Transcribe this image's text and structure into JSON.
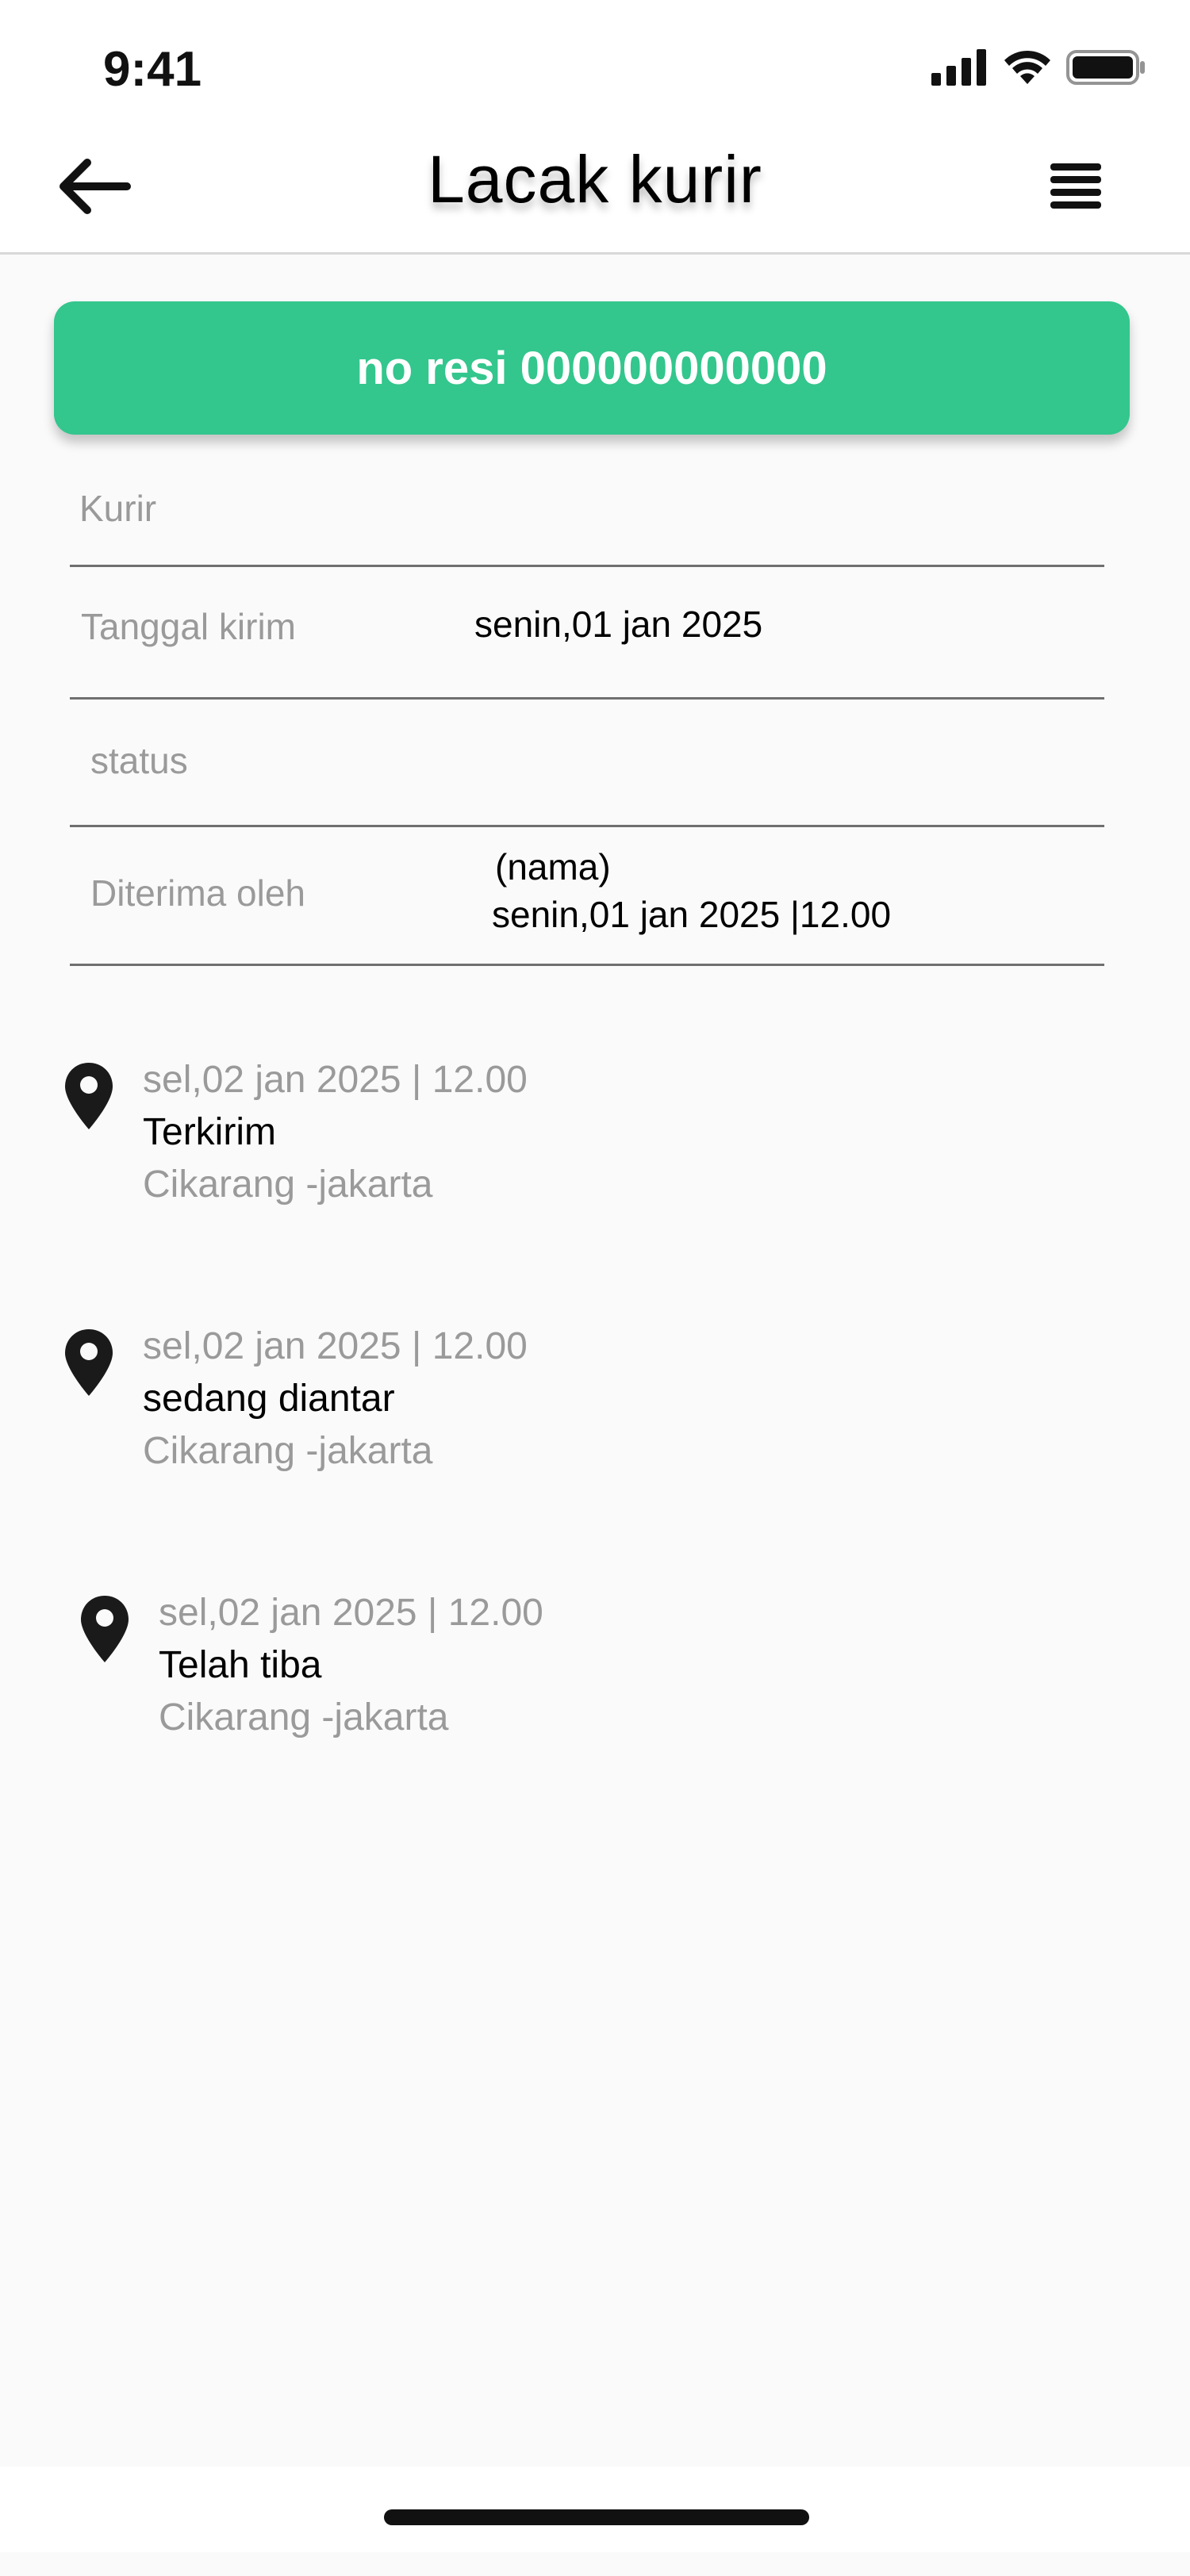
{
  "status_bar": {
    "time": "9:41"
  },
  "header": {
    "title": "Lacak  kurir"
  },
  "resi": {
    "label": "no resi 000000000000"
  },
  "info": {
    "kurir_label": "Kurir",
    "tanggal_label": "Tanggal kirim",
    "tanggal_value": "senin,01 jan 2025",
    "status_label": "status",
    "diterima_label": "Diterima oleh",
    "diterima_name": "(nama)",
    "diterima_datetime": "senin,01 jan 2025 |12.00"
  },
  "timeline": [
    {
      "date": "sel,02 jan 2025 | 12.00",
      "status": "Terkirim",
      "location": "Cikarang -jakarta"
    },
    {
      "date": "sel,02 jan 2025 | 12.00",
      "status": "sedang diantar",
      "location": "Cikarang -jakarta"
    },
    {
      "date": "sel,02 jan 2025 | 12.00",
      "status": "Telah tiba",
      "location": "Cikarang -jakarta"
    }
  ],
  "icons": {
    "back": "arrow-left-icon",
    "menu": "menu-lines-icon",
    "pin": "location-pin-icon",
    "signal": "signal-icon",
    "wifi": "wifi-icon",
    "battery": "battery-icon"
  },
  "colors": {
    "accent": "#33c68d",
    "muted_text": "#9a9a9a"
  }
}
